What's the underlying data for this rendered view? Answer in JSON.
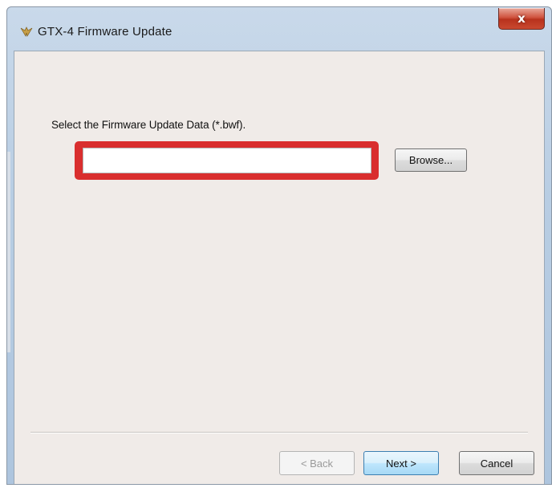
{
  "window": {
    "title": "GTX-4 Firmware Update",
    "close_label": "x",
    "app_icon": "wing-icon"
  },
  "main": {
    "instruction": "Select the Firmware Update Data (*.bwf).",
    "file_input": {
      "value": "",
      "placeholder": ""
    },
    "browse_label": "Browse...",
    "highlight_color": "#d92e2e"
  },
  "footer": {
    "back_label": "< Back",
    "next_label": "Next >",
    "cancel_label": "Cancel"
  },
  "colors": {
    "client_background": "#f0ebe8",
    "title_bar": "#b8cde3",
    "close_button": "#c9482f",
    "next_button_border": "#3c7fb1"
  }
}
